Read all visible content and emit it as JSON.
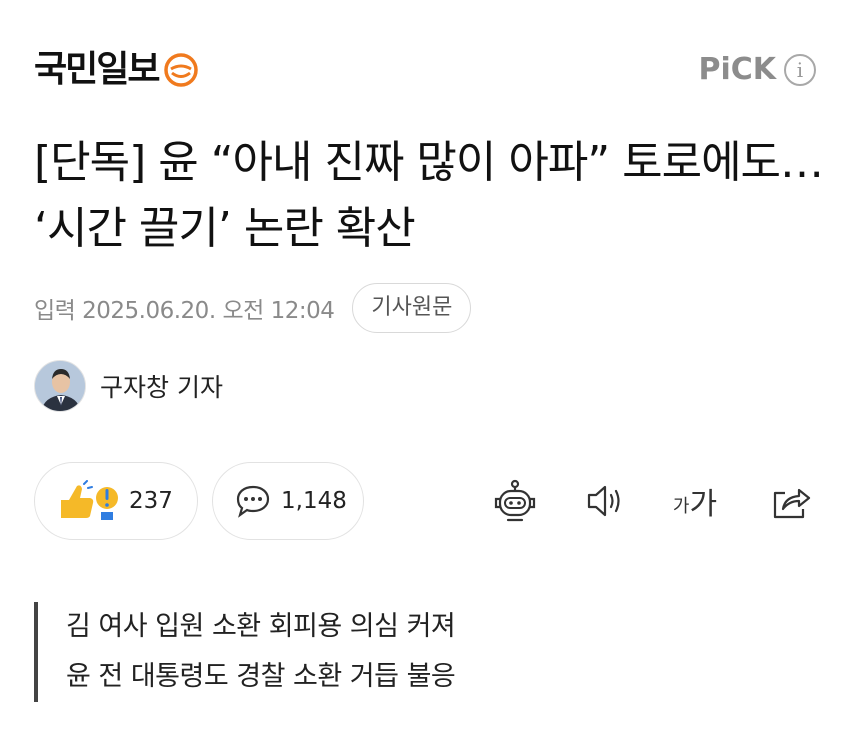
{
  "header": {
    "logo_text": "국민일보",
    "pick_text": "PiCK",
    "info_glyph": "i"
  },
  "article": {
    "title": "[단독] 윤 “아내 진짜 많이 아파” 토로에도… ‘시간 끌기’ 논란 확산",
    "date": "입력 2025.06.20. 오전 12:04",
    "original_button": "기사원문",
    "reporter": "구자창 기자"
  },
  "actions": {
    "reaction_count": "237",
    "comment_count": "1,148",
    "font_small": "가",
    "font_big": "가"
  },
  "summary": {
    "lines": [
      "김 여사 입원 소환 회피용 의심 커져",
      "윤 전 대통령도 경찰 소환 거듭 불응"
    ]
  },
  "icons": {
    "logo_mark": "smile-emblem-icon",
    "info": "info-icon",
    "reaction": "thumbs-up-icon",
    "comment": "speech-bubble-icon",
    "summary_bot": "robot-icon",
    "audio": "speaker-icon",
    "font_size": "font-size-icon",
    "share": "share-icon"
  },
  "colors": {
    "logo_mark": "#f07a1e",
    "pick_gray": "#8c8c8c",
    "reaction_yellow": "#f5b928",
    "reaction_blue": "#2f7de1"
  }
}
